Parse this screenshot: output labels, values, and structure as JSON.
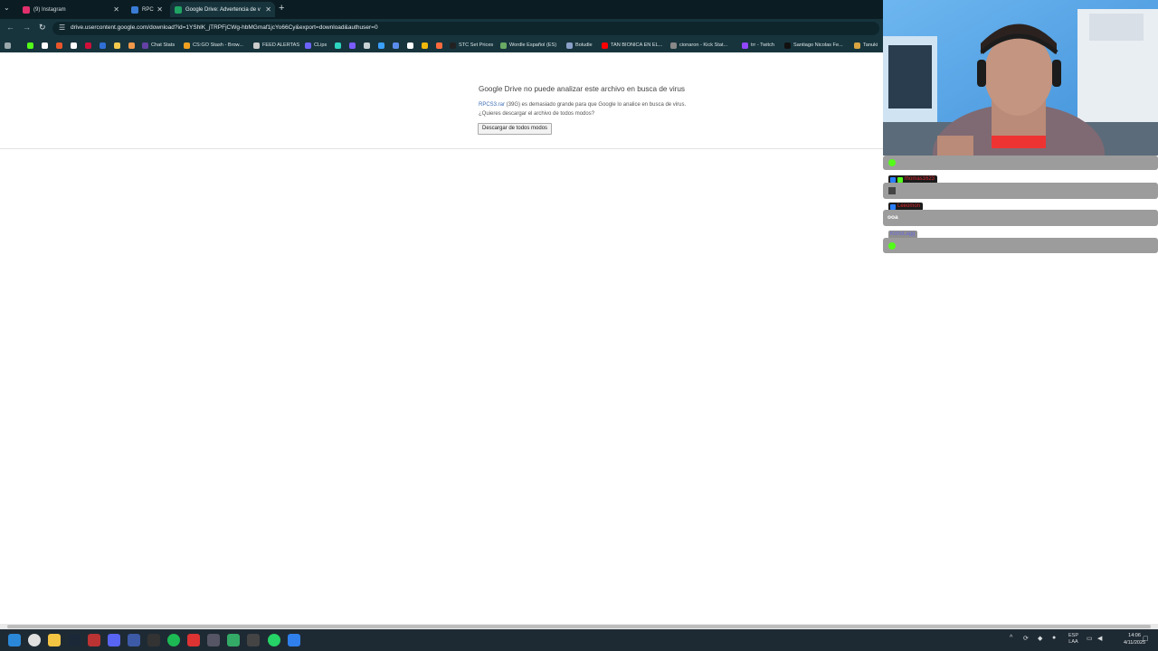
{
  "browser": {
    "tabs": [
      {
        "label": "(9) Instagram",
        "color": "#e1306c"
      },
      {
        "label": "RPC",
        "color": "#3a7bd5"
      },
      {
        "label": "Google Drive: Advertencia de v",
        "color": "#1fa463"
      }
    ],
    "new_tab": "+",
    "url": "drive.usercontent.google.com/download?id=1YShlK_jTRPFjCWg-hbMGmaf1jcYo66Cy&export=download&authuser=0",
    "bookmarks": [
      {
        "label": "Chat Stats",
        "color": "#6441a5"
      },
      {
        "label": "CS:GO Stash - Brow...",
        "color": "#f0a020"
      },
      {
        "label": "FEED ALERTAS",
        "color": "#cccccc"
      },
      {
        "label": "CLips",
        "color": "#6c63ff"
      },
      {
        "label": "STC Set Prices",
        "color": "#222222"
      },
      {
        "label": "Wordle Español (ES)",
        "color": "#6aaa64"
      },
      {
        "label": "Boludle",
        "color": "#8aa0c8"
      },
      {
        "label": "TAN BIONICA EN EL...",
        "color": "#ff0000"
      },
      {
        "label": "cionaron - Kick Stat...",
        "color": "#888888"
      },
      {
        "label": "trr - Twitch",
        "color": "#9146ff"
      },
      {
        "label": "Santiago Nicolas Fe...",
        "color": "#111111"
      },
      {
        "label": "Tanuki",
        "color": "#d9a441"
      }
    ]
  },
  "page": {
    "title": "Google Drive no puede analizar este archivo en busca de virus",
    "file_name": "RPCS3.rar",
    "message": " (39G) es demasiado grande para que Google lo analice en busca de virus. ¿Quieres descargar el archivo de todos modos?",
    "download_button": "Descargar de todos modos"
  },
  "chat": {
    "messages": [
      {
        "name": "thomas1623",
        "text": ""
      },
      {
        "name": "Leeomon",
        "text": "ooa"
      },
      {
        "name": "KohoLagg",
        "text": ""
      }
    ]
  },
  "taskbar": {
    "language": "ESP",
    "layout": "LAA",
    "time": "14:06",
    "date": "4/11/2025"
  }
}
